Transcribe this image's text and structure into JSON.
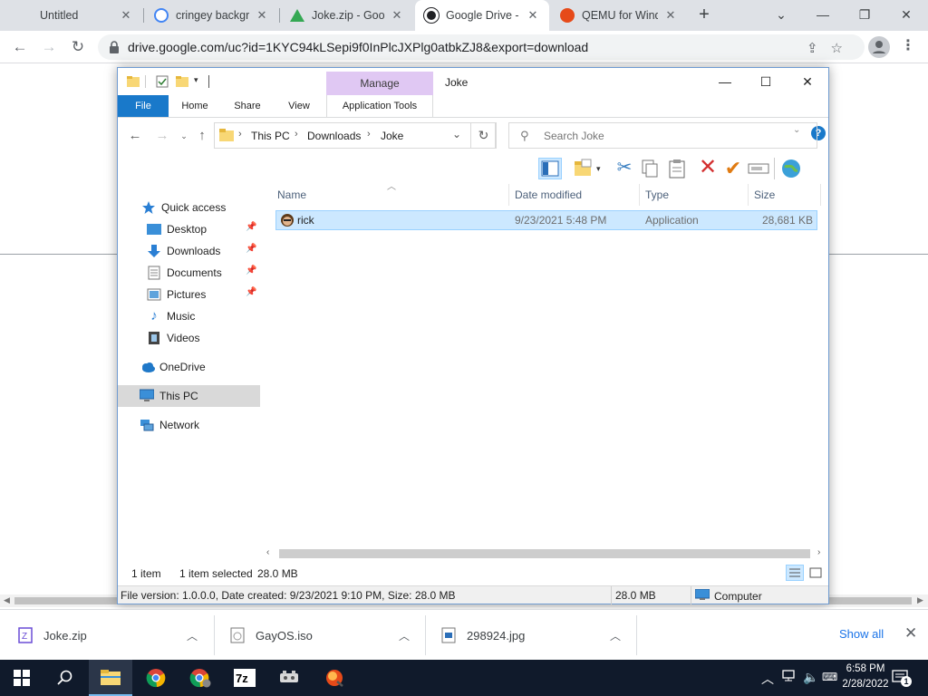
{
  "browser": {
    "tabs": [
      {
        "title": "Untitled",
        "active": false
      },
      {
        "title": "cringey backgro",
        "active": false
      },
      {
        "title": "Joke.zip - Goog",
        "active": false
      },
      {
        "title": "Google Drive - ",
        "active": true
      },
      {
        "title": "QEMU for Wind",
        "active": false
      }
    ],
    "url": "drive.google.com/uc?id=1KYC94kLSepi9f0InPlcJXPlg0atbkZJ8&export=download"
  },
  "explorer": {
    "title": "Joke",
    "manage_label": "Manage",
    "ribbon_tabs": [
      "File",
      "Home",
      "Share",
      "View",
      "Application Tools"
    ],
    "breadcrumb": [
      "This PC",
      "Downloads",
      "Joke"
    ],
    "search_placeholder": "Search Joke",
    "nav": {
      "quick_access": "Quick access",
      "items": [
        "Desktop",
        "Downloads",
        "Documents",
        "Pictures",
        "Music",
        "Videos"
      ],
      "onedrive": "OneDrive",
      "this_pc": "This PC",
      "network": "Network"
    },
    "columns": [
      "Name",
      "Date modified",
      "Type",
      "Size"
    ],
    "files": [
      {
        "name": "rick",
        "date_modified": "9/23/2021 5:48 PM",
        "type": "Application",
        "size": "28,681 KB"
      }
    ],
    "status": {
      "item_count": "1 item",
      "selected": "1 item selected",
      "selected_size": "28.0 MB",
      "details": "File version: 1.0.0.0, Date created: 9/23/2021 9:10 PM, Size: 28.0 MB",
      "size": "28.0 MB",
      "location": "Computer"
    }
  },
  "downloads": {
    "items": [
      "Joke.zip",
      "GayOS.iso",
      "298924.jpg"
    ],
    "show_all": "Show all"
  },
  "taskbar": {
    "time": "6:58 PM",
    "date": "2/28/2022",
    "notification_count": "1"
  }
}
